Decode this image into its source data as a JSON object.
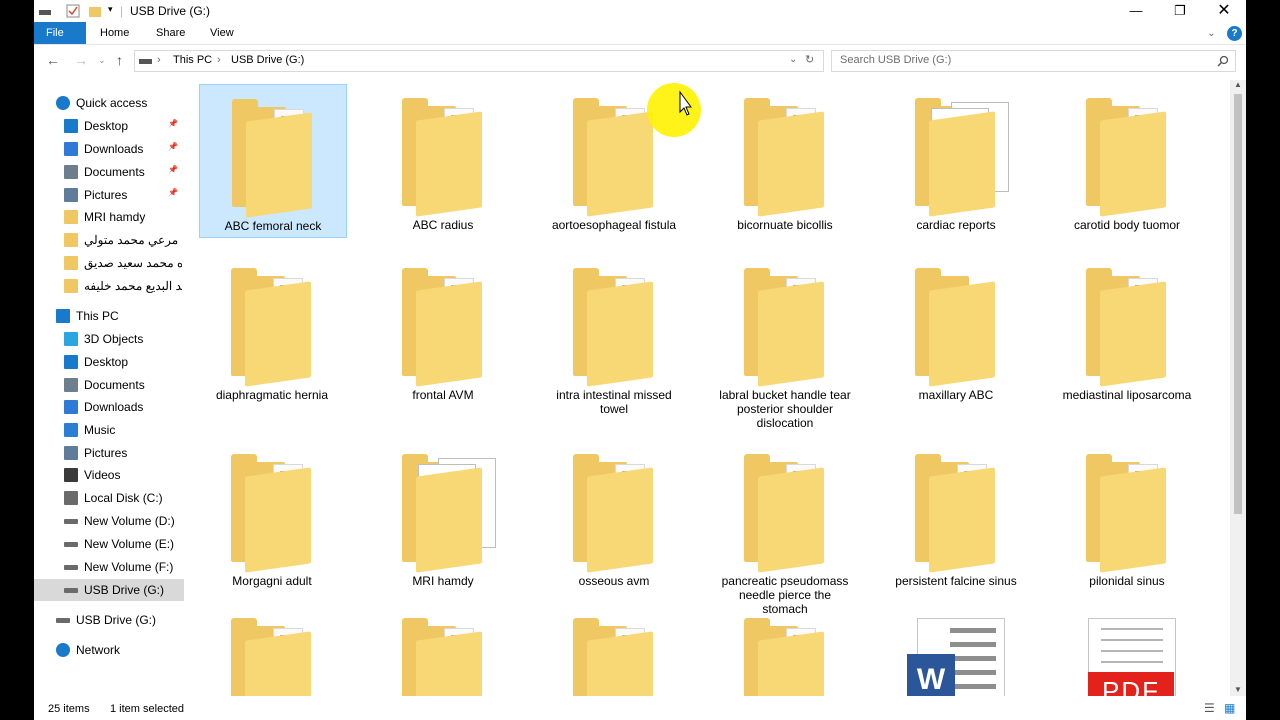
{
  "window": {
    "title": "USB Drive (G:)"
  },
  "ribbon": {
    "tabs": [
      "File",
      "Home",
      "Share",
      "View"
    ]
  },
  "address": {
    "crumbs": [
      "This PC",
      "USB Drive (G:)"
    ],
    "search_placeholder": "Search USB Drive (G:)"
  },
  "nav": {
    "items": [
      {
        "label": "Quick access",
        "icon": "star-icon",
        "color": "#1979ca"
      },
      {
        "label": "Desktop",
        "icon": "desktop-icon",
        "color": "#1979ca"
      },
      {
        "label": "Downloads",
        "icon": "download-arrow-icon",
        "color": "#2f7ad6"
      },
      {
        "label": "Documents",
        "icon": "document-icon",
        "color": "#6d7f8d"
      },
      {
        "label": "Pictures",
        "icon": "pictures-icon",
        "color": "#5f7c9b"
      },
      {
        "label": "MRI hamdy",
        "icon": "folder-icon",
        "color": "#efc864"
      },
      {
        "label": "د مرعي محمد متولي",
        "icon": "folder-icon",
        "color": "#efc864"
      },
      {
        "label": "ه محمد سعيد صديق",
        "icon": "folder-icon",
        "color": "#efc864"
      },
      {
        "label": "بيد البديع محمد خليفه",
        "icon": "folder-icon",
        "color": "#efc864"
      },
      {
        "label": "This PC",
        "icon": "computer-icon",
        "color": "#1979ca"
      },
      {
        "label": "3D Objects",
        "icon": "cube-icon",
        "color": "#2aa7e0"
      },
      {
        "label": "Desktop",
        "icon": "desktop-icon",
        "color": "#1979ca"
      },
      {
        "label": "Documents",
        "icon": "document-icon",
        "color": "#6d7f8d"
      },
      {
        "label": "Downloads",
        "icon": "download-arrow-icon",
        "color": "#2f7ad6"
      },
      {
        "label": "Music",
        "icon": "music-note-icon",
        "color": "#2a7fd4"
      },
      {
        "label": "Pictures",
        "icon": "pictures-icon",
        "color": "#5f7c9b"
      },
      {
        "label": "Videos",
        "icon": "video-icon",
        "color": "#3a3a3a"
      },
      {
        "label": "Local Disk (C:)",
        "icon": "windows-drive-icon",
        "color": "#6a6a6a"
      },
      {
        "label": "New Volume (D:)",
        "icon": "drive-icon",
        "color": "#6a6a6a"
      },
      {
        "label": "New Volume (E:)",
        "icon": "drive-icon",
        "color": "#6a6a6a"
      },
      {
        "label": "New Volume (F:)",
        "icon": "drive-icon",
        "color": "#6a6a6a"
      },
      {
        "label": "USB Drive (G:)",
        "icon": "usb-drive-icon",
        "color": "#6a6a6a",
        "selected": true
      },
      {
        "label": "USB Drive (G:)",
        "icon": "usb-drive-icon",
        "color": "#6a6a6a"
      },
      {
        "label": "Network",
        "icon": "network-icon",
        "color": "#1979ca"
      }
    ]
  },
  "files": [
    {
      "name": "ABC femoral neck",
      "kind": "folder",
      "selected": true
    },
    {
      "name": "ABC radius",
      "kind": "folder"
    },
    {
      "name": "aortoesophageal fistula",
      "kind": "folder"
    },
    {
      "name": "bicornuate bicollis",
      "kind": "folder"
    },
    {
      "name": "cardiac reports",
      "kind": "folder-docs"
    },
    {
      "name": "carotid body tuomor",
      "kind": "folder"
    },
    {
      "name": "diaphragmatic hernia",
      "kind": "folder"
    },
    {
      "name": "frontal AVM",
      "kind": "folder"
    },
    {
      "name": "intra intestinal missed towel",
      "kind": "folder"
    },
    {
      "name": "labral bucket handle tear posterior shoulder dislocation",
      "kind": "folder"
    },
    {
      "name": "maxillary ABC",
      "kind": "folder-empty"
    },
    {
      "name": "mediastinal liposarcoma",
      "kind": "folder"
    },
    {
      "name": "Morgagni adult",
      "kind": "folder"
    },
    {
      "name": "MRI hamdy",
      "kind": "folder-docs"
    },
    {
      "name": "osseous avm",
      "kind": "folder"
    },
    {
      "name": "pancreatic pseudomass needle pierce the stomach",
      "kind": "folder"
    },
    {
      "name": "persistent falcine  sinus",
      "kind": "folder"
    },
    {
      "name": "pilonidal sinus",
      "kind": "folder"
    },
    {
      "name": "",
      "kind": "folder"
    },
    {
      "name": "",
      "kind": "folder"
    },
    {
      "name": "",
      "kind": "folder"
    },
    {
      "name": "",
      "kind": "folder"
    },
    {
      "name": "",
      "kind": "word-doc",
      "badge": "W"
    },
    {
      "name": "",
      "kind": "pdf-doc",
      "badge": "PDF"
    }
  ],
  "status": {
    "count": "25 items",
    "selection": "1 item selected"
  },
  "colors": {
    "accent": "#1979ca",
    "selection_bg": "#cce8ff",
    "folder": "#efc864",
    "word": "#2b579a",
    "pdf": "#e3221c"
  }
}
